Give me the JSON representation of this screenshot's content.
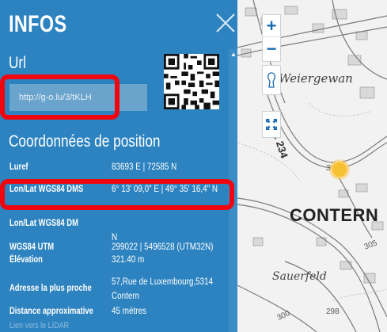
{
  "panel": {
    "title": "INFOS",
    "url_section": {
      "title": "Url",
      "url_value": "http://g-o.lu/3/tKLH"
    },
    "coords_section": {
      "title": "Coordonnées de position",
      "rows": [
        {
          "label": "Luref",
          "value": "83693 E | 72585 N"
        },
        {
          "label": "Lon/Lat WGS84 DMS",
          "value": "6° 13' 09,0\" E | 49° 35' 16,4\" N"
        },
        {
          "label": "Lon/Lat WGS84 DM",
          "value": "",
          "value2": "N"
        },
        {
          "label": "WGS84 UTM",
          "value": "299022 | 5496528 (UTM32N)"
        },
        {
          "label": "Élévation",
          "value": "321.40 m"
        },
        {
          "label": "Adresse la plus proche",
          "value": "57,Rue de Luxembourg,5314",
          "value2": "Contern"
        },
        {
          "label": "Distance approximative",
          "value": "45 mètres"
        }
      ],
      "lidar_link": "Lien vers le LIDAR"
    }
  },
  "map": {
    "labels": {
      "weiergewan": "Weiergewan",
      "cr234": "C.R. 234",
      "contern": "CONTERN",
      "sauerfeld": "Sauerfeld",
      "e320": "320",
      "e305": "305",
      "e298": "298",
      "e300": "300"
    },
    "controls": {
      "zoom_in": "+",
      "zoom_out": "−"
    },
    "marker_color": "#f6c233"
  },
  "colors": {
    "panel_bg": "#2d83c0",
    "highlight": "#f0060f"
  }
}
